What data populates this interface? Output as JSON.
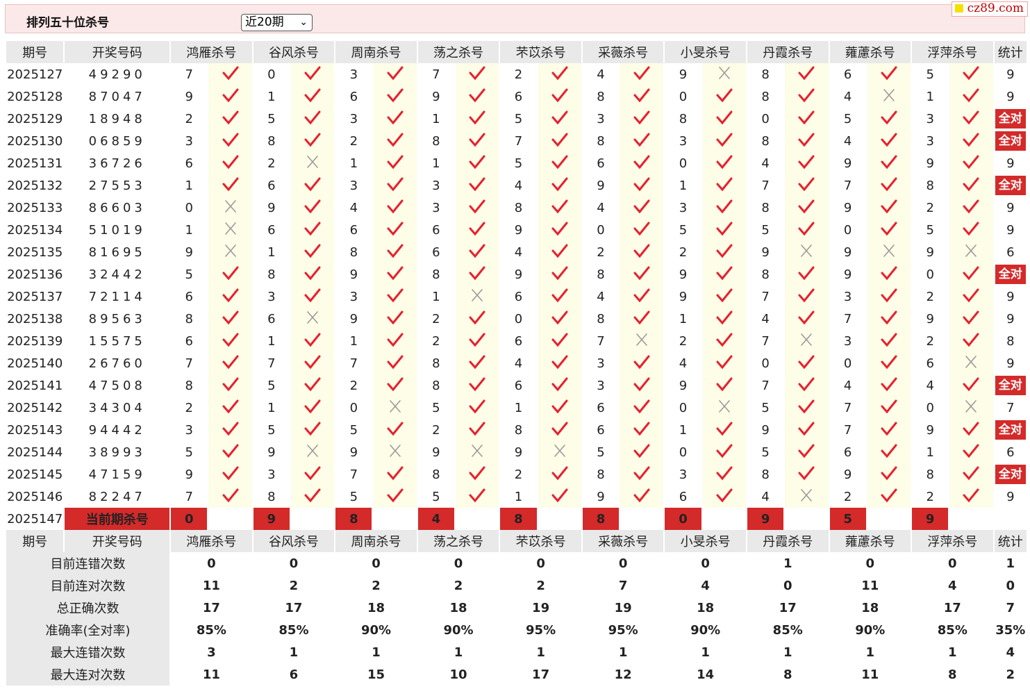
{
  "header": {
    "title": "排列五十位杀号",
    "period_select": "近20期",
    "site_badge": "cz89.com"
  },
  "columns": {
    "period": "期号",
    "winning": "开奖号码",
    "experts": [
      "鸿雁杀号",
      "谷风杀号",
      "周南杀号",
      "荡之杀号",
      "芣苡杀号",
      "采薇杀号",
      "小旻杀号",
      "丹霞杀号",
      "蕹藘杀号",
      "浮萍杀号"
    ],
    "stat": "统计"
  },
  "all_correct_label": "全对",
  "rows": [
    {
      "period": "2025127",
      "win": "49290",
      "kills": [
        7,
        0,
        3,
        7,
        2,
        4,
        9,
        8,
        6,
        5
      ],
      "ok": [
        1,
        1,
        1,
        1,
        1,
        1,
        0,
        1,
        1,
        1
      ],
      "total": "9"
    },
    {
      "period": "2025128",
      "win": "87047",
      "kills": [
        9,
        1,
        6,
        9,
        6,
        8,
        0,
        8,
        4,
        1
      ],
      "ok": [
        1,
        1,
        1,
        1,
        1,
        1,
        1,
        1,
        0,
        1
      ],
      "total": "9"
    },
    {
      "period": "2025129",
      "win": "18948",
      "kills": [
        2,
        5,
        3,
        1,
        5,
        3,
        8,
        0,
        5,
        3
      ],
      "ok": [
        1,
        1,
        1,
        1,
        1,
        1,
        1,
        1,
        1,
        1
      ],
      "total": "全对"
    },
    {
      "period": "2025130",
      "win": "06859",
      "kills": [
        3,
        8,
        2,
        8,
        7,
        8,
        3,
        8,
        4,
        3
      ],
      "ok": [
        1,
        1,
        1,
        1,
        1,
        1,
        1,
        1,
        1,
        1
      ],
      "total": "全对"
    },
    {
      "period": "2025131",
      "win": "36726",
      "kills": [
        6,
        2,
        1,
        1,
        5,
        6,
        0,
        4,
        9,
        9
      ],
      "ok": [
        1,
        0,
        1,
        1,
        1,
        1,
        1,
        1,
        1,
        1
      ],
      "total": "9"
    },
    {
      "period": "2025132",
      "win": "27553",
      "kills": [
        1,
        6,
        3,
        3,
        4,
        9,
        1,
        7,
        7,
        8
      ],
      "ok": [
        1,
        1,
        1,
        1,
        1,
        1,
        1,
        1,
        1,
        1
      ],
      "total": "全对"
    },
    {
      "period": "2025133",
      "win": "86603",
      "kills": [
        0,
        9,
        4,
        3,
        8,
        4,
        3,
        8,
        9,
        2
      ],
      "ok": [
        0,
        1,
        1,
        1,
        1,
        1,
        1,
        1,
        1,
        1
      ],
      "total": "9"
    },
    {
      "period": "2025134",
      "win": "51019",
      "kills": [
        1,
        6,
        6,
        6,
        9,
        0,
        5,
        5,
        0,
        5
      ],
      "ok": [
        0,
        1,
        1,
        1,
        1,
        1,
        1,
        1,
        1,
        1
      ],
      "total": "9"
    },
    {
      "period": "2025135",
      "win": "81695",
      "kills": [
        9,
        1,
        8,
        6,
        4,
        2,
        2,
        9,
        9,
        9
      ],
      "ok": [
        0,
        1,
        1,
        1,
        1,
        1,
        1,
        0,
        0,
        0
      ],
      "total": "6"
    },
    {
      "period": "2025136",
      "win": "32442",
      "kills": [
        5,
        8,
        9,
        8,
        9,
        8,
        9,
        8,
        9,
        0
      ],
      "ok": [
        1,
        1,
        1,
        1,
        1,
        1,
        1,
        1,
        1,
        1
      ],
      "total": "全对"
    },
    {
      "period": "2025137",
      "win": "72114",
      "kills": [
        6,
        3,
        3,
        1,
        6,
        4,
        9,
        7,
        3,
        2
      ],
      "ok": [
        1,
        1,
        1,
        0,
        1,
        1,
        1,
        1,
        1,
        1
      ],
      "total": "9"
    },
    {
      "period": "2025138",
      "win": "89563",
      "kills": [
        8,
        6,
        9,
        2,
        0,
        8,
        1,
        4,
        7,
        9
      ],
      "ok": [
        1,
        0,
        1,
        1,
        1,
        1,
        1,
        1,
        1,
        1
      ],
      "total": "9"
    },
    {
      "period": "2025139",
      "win": "15575",
      "kills": [
        6,
        1,
        1,
        2,
        6,
        7,
        2,
        7,
        3,
        2
      ],
      "ok": [
        1,
        1,
        1,
        1,
        1,
        0,
        1,
        0,
        1,
        1
      ],
      "total": "8"
    },
    {
      "period": "2025140",
      "win": "26760",
      "kills": [
        7,
        7,
        7,
        8,
        4,
        3,
        4,
        0,
        0,
        6
      ],
      "ok": [
        1,
        1,
        1,
        1,
        1,
        1,
        1,
        1,
        1,
        0
      ],
      "total": "9"
    },
    {
      "period": "2025141",
      "win": "47508",
      "kills": [
        8,
        5,
        2,
        8,
        6,
        3,
        9,
        7,
        4,
        4
      ],
      "ok": [
        1,
        1,
        1,
        1,
        1,
        1,
        1,
        1,
        1,
        1
      ],
      "total": "全对"
    },
    {
      "period": "2025142",
      "win": "34304",
      "kills": [
        2,
        1,
        0,
        5,
        1,
        6,
        0,
        5,
        7,
        0
      ],
      "ok": [
        1,
        1,
        0,
        1,
        1,
        1,
        0,
        1,
        1,
        0
      ],
      "total": "7"
    },
    {
      "period": "2025143",
      "win": "94442",
      "kills": [
        3,
        5,
        5,
        2,
        8,
        6,
        1,
        9,
        7,
        9
      ],
      "ok": [
        1,
        1,
        1,
        1,
        1,
        1,
        1,
        1,
        1,
        1
      ],
      "total": "全对"
    },
    {
      "period": "2025144",
      "win": "38993",
      "kills": [
        5,
        9,
        9,
        9,
        9,
        5,
        0,
        5,
        6,
        1
      ],
      "ok": [
        1,
        0,
        0,
        0,
        0,
        1,
        1,
        1,
        1,
        1
      ],
      "total": "6"
    },
    {
      "period": "2025145",
      "win": "47159",
      "kills": [
        9,
        3,
        7,
        8,
        2,
        8,
        3,
        8,
        9,
        8
      ],
      "ok": [
        1,
        1,
        1,
        1,
        1,
        1,
        1,
        1,
        1,
        1
      ],
      "total": "全对"
    },
    {
      "period": "2025146",
      "win": "82247",
      "kills": [
        7,
        8,
        5,
        5,
        1,
        9,
        6,
        4,
        2,
        2
      ],
      "ok": [
        1,
        1,
        1,
        1,
        1,
        1,
        1,
        0,
        1,
        1
      ],
      "total": "9"
    }
  ],
  "current": {
    "period": "2025147",
    "label": "当前期杀号",
    "kills": [
      "0",
      "9",
      "8",
      "4",
      "8",
      "8",
      "0",
      "9",
      "5",
      "9"
    ]
  },
  "stats": [
    {
      "label": "目前连错次数",
      "values": [
        "0",
        "0",
        "0",
        "0",
        "0",
        "0",
        "0",
        "1",
        "0",
        "0"
      ],
      "total": "1",
      "pct": false
    },
    {
      "label": "目前连对次数",
      "values": [
        "11",
        "2",
        "2",
        "2",
        "2",
        "7",
        "4",
        "0",
        "11",
        "4"
      ],
      "total": "0",
      "pct": false
    },
    {
      "label": "总正确次数",
      "values": [
        "17",
        "17",
        "18",
        "18",
        "19",
        "19",
        "18",
        "17",
        "18",
        "17"
      ],
      "total": "7",
      "pct": false
    },
    {
      "label": "准确率(全对率)",
      "values": [
        "85%",
        "85%",
        "90%",
        "90%",
        "95%",
        "95%",
        "90%",
        "85%",
        "90%",
        "85%"
      ],
      "total": "35%",
      "pct": true
    },
    {
      "label": "最大连错次数",
      "values": [
        "3",
        "1",
        "1",
        "1",
        "1",
        "1",
        "1",
        "1",
        "1",
        "1"
      ],
      "total": "4",
      "pct": false
    },
    {
      "label": "最大连对次数",
      "values": [
        "11",
        "6",
        "15",
        "10",
        "17",
        "12",
        "14",
        "8",
        "11",
        "8"
      ],
      "total": "2",
      "pct": false
    }
  ]
}
